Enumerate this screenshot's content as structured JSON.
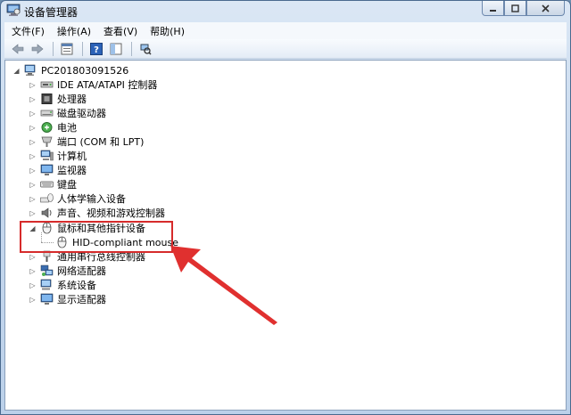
{
  "window": {
    "title": "设备管理器",
    "icon": "device-manager-icon",
    "buttons": {
      "minimize": "minimize-icon",
      "maximize": "maximize-icon",
      "close": "close-icon"
    }
  },
  "menu": {
    "items": [
      "文件(F)",
      "操作(A)",
      "查看(V)",
      "帮助(H)"
    ]
  },
  "toolbar": {
    "buttons": [
      "back-arrow-icon",
      "forward-arrow-icon",
      "properties-icon",
      "help-icon",
      "show-hide-icon",
      "scan-hardware-icon"
    ]
  },
  "tree": {
    "root": "PC201803091526",
    "categories": [
      {
        "label": "IDE ATA/ATAPI 控制器",
        "icon": "ide-controller-icon"
      },
      {
        "label": "处理器",
        "icon": "processor-icon"
      },
      {
        "label": "磁盘驱动器",
        "icon": "disk-drive-icon"
      },
      {
        "label": "电池",
        "icon": "battery-icon"
      },
      {
        "label": "端口 (COM 和 LPT)",
        "icon": "port-icon"
      },
      {
        "label": "计算机",
        "icon": "computer-icon"
      },
      {
        "label": "监视器",
        "icon": "monitor-icon"
      },
      {
        "label": "键盘",
        "icon": "keyboard-icon"
      },
      {
        "label": "人体学输入设备",
        "icon": "hid-icon"
      },
      {
        "label": "声音、视频和游戏控制器",
        "icon": "sound-icon"
      },
      {
        "label": "鼠标和其他指针设备",
        "icon": "mouse-icon",
        "expanded": true
      },
      {
        "label": "通用串行总线控制器",
        "icon": "usb-icon"
      },
      {
        "label": "网络适配器",
        "icon": "network-adapter-icon"
      },
      {
        "label": "系统设备",
        "icon": "system-device-icon"
      },
      {
        "label": "显示适配器",
        "icon": "display-adapter-icon"
      }
    ],
    "mouse_child": {
      "label": "HID-compliant mouse",
      "icon": "mouse-icon"
    }
  },
  "annotation": {
    "color": "#d62b2b"
  }
}
